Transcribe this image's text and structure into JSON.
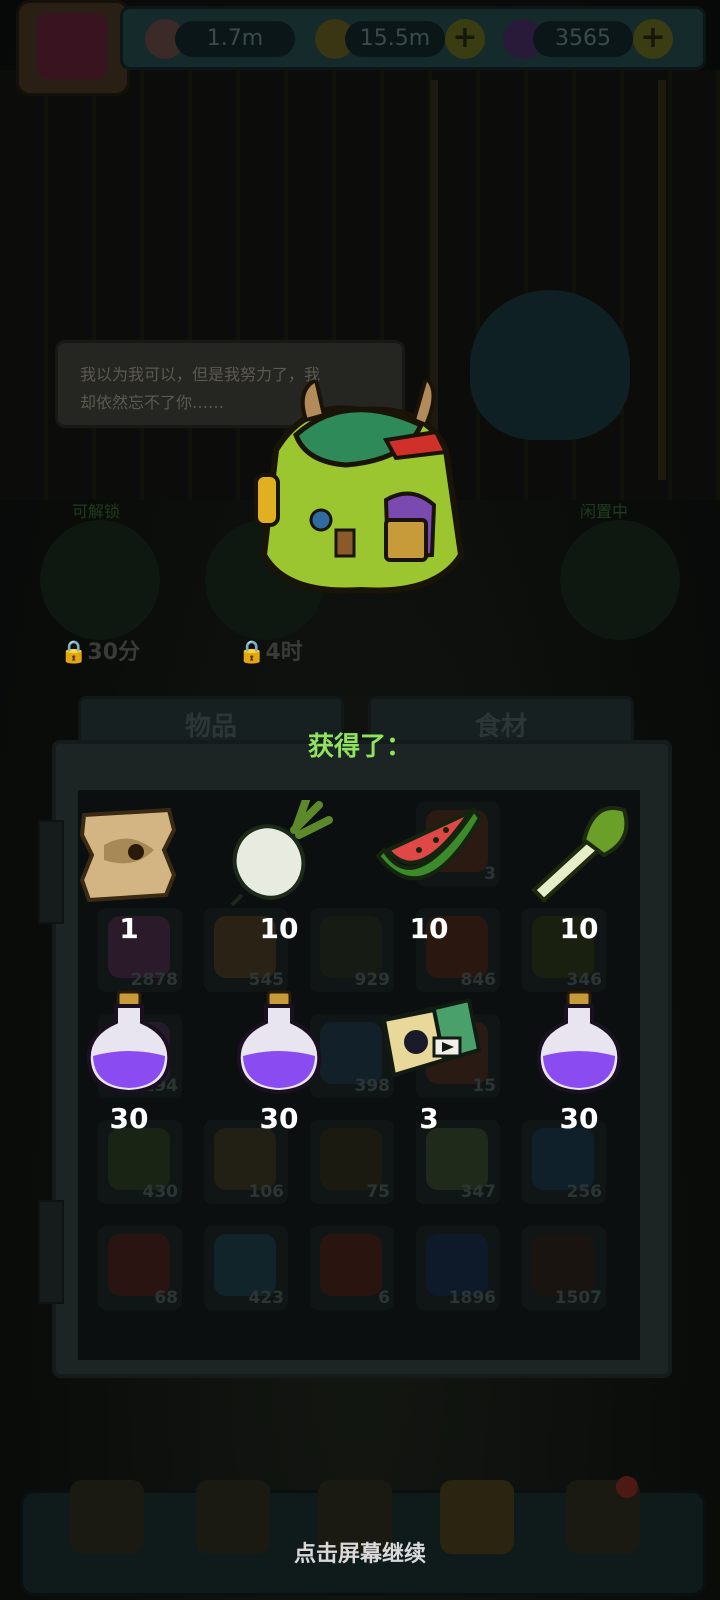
{
  "header": {
    "eyes_value": "1.7m",
    "coins_value": "15.5m",
    "potions_value": "3565",
    "icons": {
      "eyes": "eyeball-icon",
      "coins": "coin-icon",
      "potions": "potion-icon",
      "plus": "plus-icon"
    }
  },
  "dialogue": {
    "line1": "我以为我可以，但是我努力了，我",
    "line2": "却依然忘不了你……"
  },
  "slots": {
    "left_label": "可解锁",
    "right_label": "闲置中",
    "lock1": "30分",
    "lock2": "4时"
  },
  "inventory": {
    "tab_items": "物品",
    "tab_food": "食材",
    "background_counts": [
      "3",
      "2878",
      "545",
      "929",
      "846",
      "346",
      "194",
      "398",
      "15",
      "430",
      "106",
      "75",
      "347",
      "256",
      "68",
      "423",
      "6",
      "1896",
      "1507"
    ]
  },
  "reward": {
    "title": "获得了：",
    "items": [
      {
        "name": "map-scroll",
        "qty": "1"
      },
      {
        "name": "radish",
        "qty": "10"
      },
      {
        "name": "watermelon",
        "qty": "10"
      },
      {
        "name": "celery",
        "qty": "10"
      },
      {
        "name": "purple-potion",
        "qty": "30"
      },
      {
        "name": "purple-potion",
        "qty": "30"
      },
      {
        "name": "video-card",
        "qty": "3"
      },
      {
        "name": "purple-potion",
        "qty": "30"
      }
    ]
  },
  "footer": {
    "continue_text": "点击屏幕继续"
  },
  "colors": {
    "accent_green": "#8fe35d",
    "potion_purple": "#8a4cf0"
  }
}
